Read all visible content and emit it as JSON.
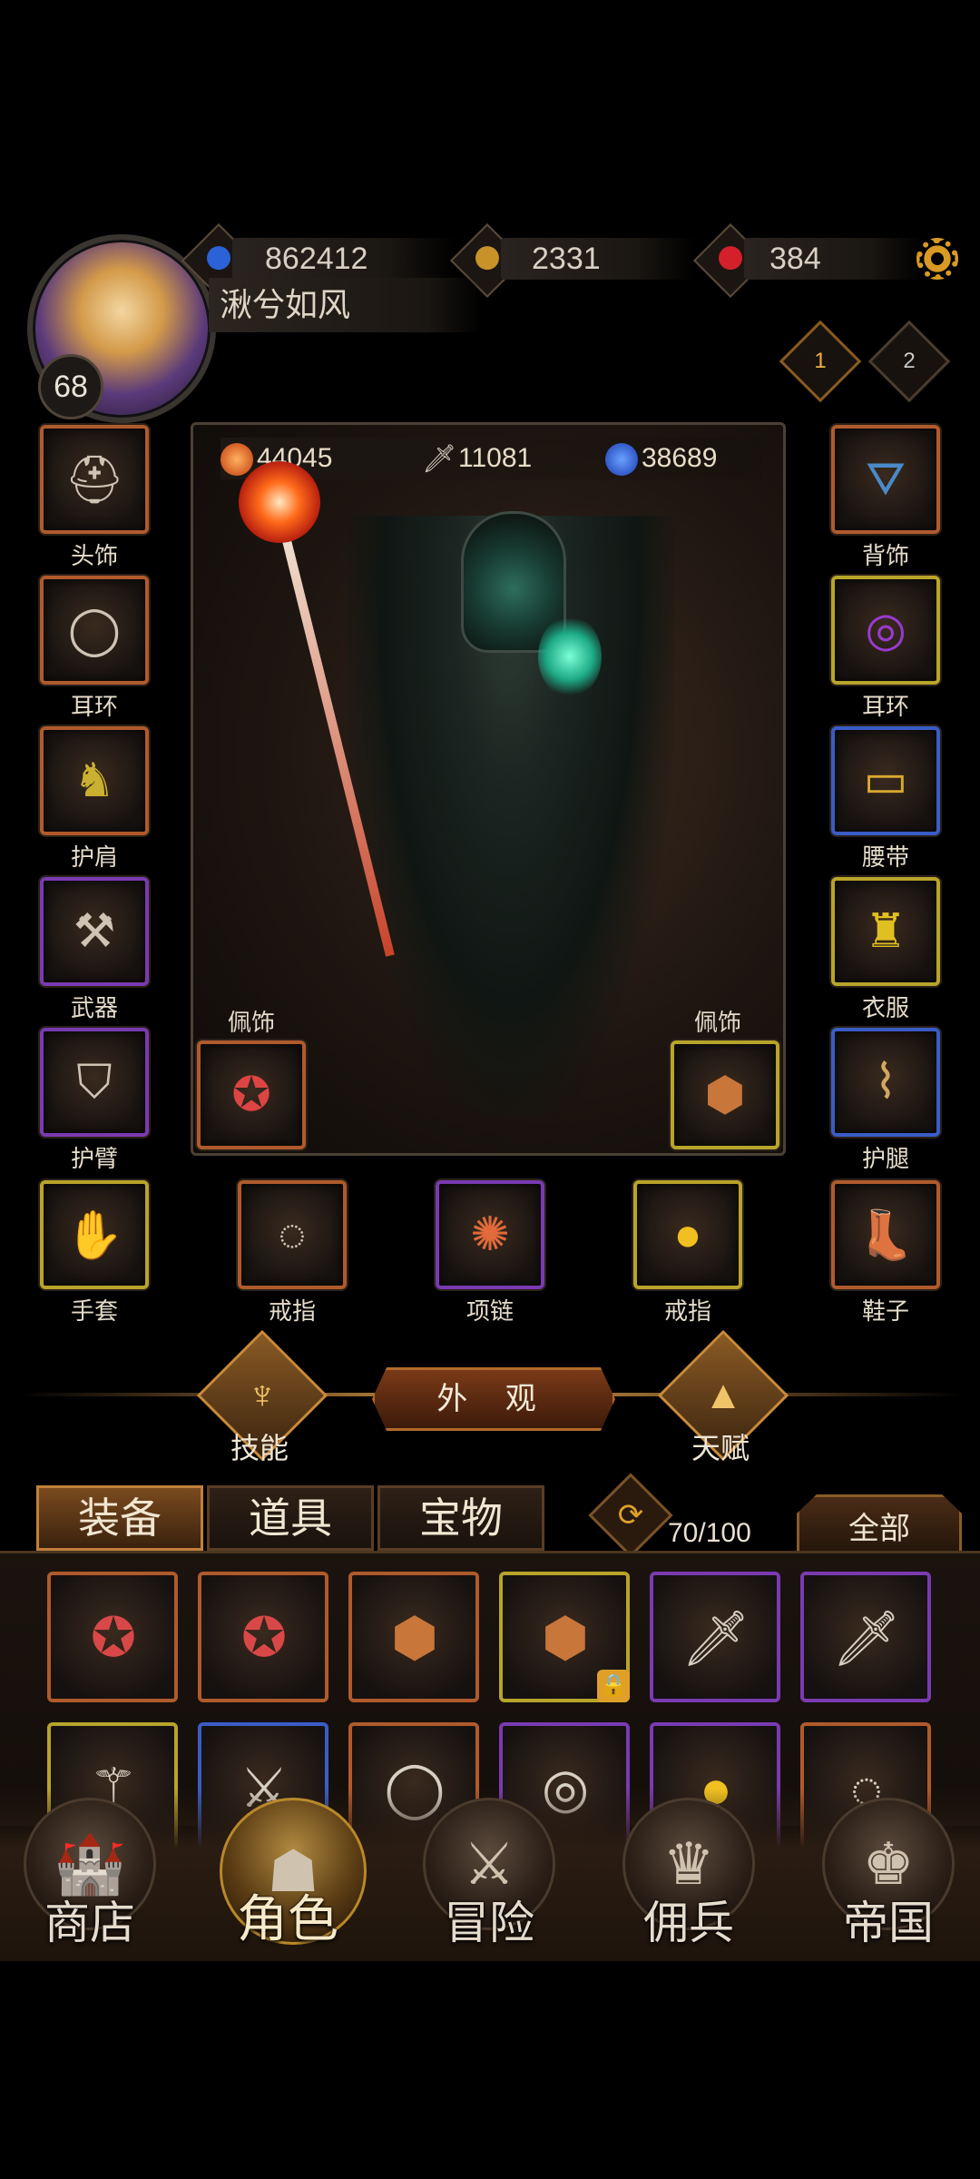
{
  "player": {
    "name": "湫兮如风",
    "level": "68"
  },
  "currencies": [
    {
      "icon": "gem-blue-icon",
      "value": "862412"
    },
    {
      "icon": "gold-coin-icon",
      "value": "2331"
    },
    {
      "icon": "ruby-icon",
      "value": "384"
    }
  ],
  "ranks": [
    "1",
    "2"
  ],
  "character_stats": [
    {
      "icon": "fire-orb-icon",
      "value": "44045",
      "color": "#e86a1a"
    },
    {
      "icon": "sword-icon",
      "value": "11081",
      "color": "#cfc8c0"
    },
    {
      "icon": "mana-orb-icon",
      "value": "38689",
      "color": "#2a5ad8"
    }
  ],
  "equipment_left": [
    {
      "label": "头饰",
      "icon": "helmet-icon",
      "rarity": "orange"
    },
    {
      "label": "耳环",
      "icon": "earring-icon",
      "rarity": "orange"
    },
    {
      "label": "护肩",
      "icon": "shoulder-icon",
      "rarity": "orange"
    },
    {
      "label": "武器",
      "icon": "axe-icon",
      "rarity": "purple"
    },
    {
      "label": "护臂",
      "icon": "bracer-icon",
      "rarity": "purple"
    }
  ],
  "equipment_right": [
    {
      "label": "背饰",
      "icon": "cape-icon",
      "rarity": "orange"
    },
    {
      "label": "耳环",
      "icon": "earring-icon",
      "rarity": "yellow"
    },
    {
      "label": "腰带",
      "icon": "belt-icon",
      "rarity": "blue"
    },
    {
      "label": "衣服",
      "icon": "armor-icon",
      "rarity": "yellow"
    },
    {
      "label": "护腿",
      "icon": "leggings-icon",
      "rarity": "blue"
    }
  ],
  "equipment_bottom": [
    {
      "label": "手套",
      "icon": "glove-icon",
      "rarity": "yellow"
    },
    {
      "label": "戒指",
      "icon": "ring-icon",
      "rarity": "orange"
    },
    {
      "label": "项链",
      "icon": "necklace-icon",
      "rarity": "purple"
    },
    {
      "label": "戒指",
      "icon": "gold-ring-icon",
      "rarity": "yellow"
    },
    {
      "label": "鞋子",
      "icon": "boots-icon",
      "rarity": "orange"
    }
  ],
  "pendants": [
    {
      "label": "佩饰",
      "icon": "pendant-icon",
      "rarity": "orange"
    },
    {
      "label": "佩饰",
      "icon": "pendant-icon",
      "rarity": "yellow"
    }
  ],
  "actions": {
    "skills": "技能",
    "appearance": "外 观",
    "talent": "天赋"
  },
  "inventory": {
    "tabs": [
      "装备",
      "道具",
      "宝物"
    ],
    "active_tab": "装备",
    "capacity": "70/100",
    "filter": "全部",
    "row1": [
      {
        "icon": "pendant-icon",
        "rarity": "orange",
        "locked": false
      },
      {
        "icon": "pendant-icon",
        "rarity": "orange",
        "locked": false
      },
      {
        "icon": "pendant-icon",
        "rarity": "orange",
        "locked": false
      },
      {
        "icon": "pendant-icon",
        "rarity": "yellow",
        "locked": true
      },
      {
        "icon": "dagger-icon",
        "rarity": "purple",
        "locked": false
      },
      {
        "icon": "dagger-icon",
        "rarity": "purple",
        "locked": false
      }
    ],
    "row2": [
      {
        "icon": "staff-icon",
        "rarity": "yellow"
      },
      {
        "icon": "sword-icon",
        "rarity": "blue"
      },
      {
        "icon": "ring-icon",
        "rarity": "orange"
      },
      {
        "icon": "earring-icon",
        "rarity": "purple"
      },
      {
        "icon": "gold-ring-icon",
        "rarity": "purple"
      },
      {
        "icon": "ring-icon",
        "rarity": "orange"
      }
    ]
  },
  "nav": [
    {
      "label": "商店",
      "icon": "shop-icon",
      "active": false
    },
    {
      "label": "角色",
      "icon": "hood-icon",
      "active": true
    },
    {
      "label": "冒险",
      "icon": "crossed-swords-icon",
      "active": false
    },
    {
      "label": "佣兵",
      "icon": "mercenary-icon",
      "active": false
    },
    {
      "label": "帝国",
      "icon": "crown-icon",
      "active": false
    }
  ]
}
